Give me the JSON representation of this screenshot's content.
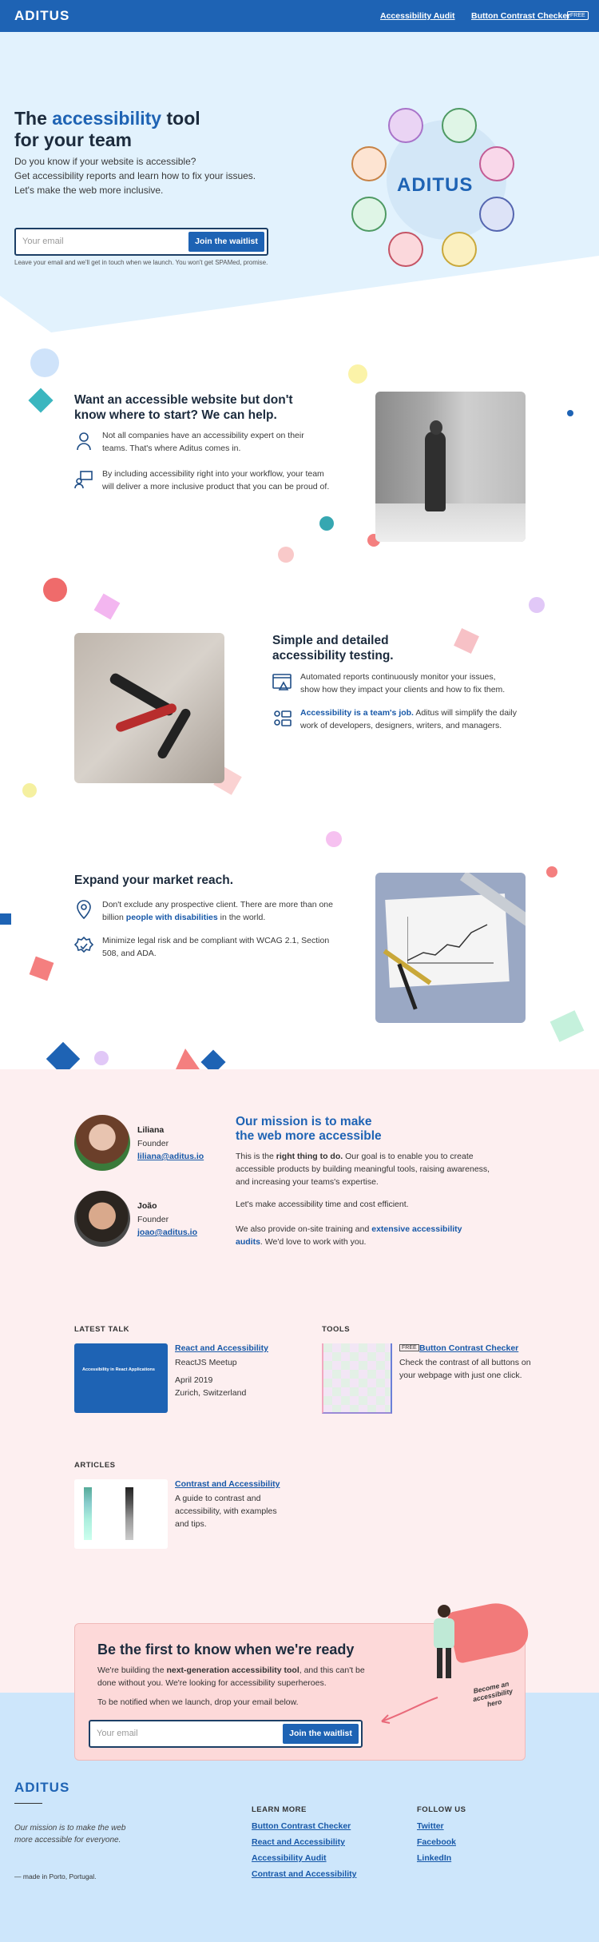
{
  "header": {
    "logo": "ADITUS",
    "nav": [
      "Accessibility Audit",
      "Button Contrast Checker"
    ],
    "free_badge": "FREE"
  },
  "hero": {
    "title_pre": "The ",
    "title_accent": "accessibility",
    "title_post": " tool for your team",
    "subtitle": [
      "Do you know if your website is accessible?",
      "Get accessibility reports and learn how to fix your issues.",
      "Let's make the web more inclusive."
    ],
    "email_placeholder": "Your email",
    "button": "Join the waitlist",
    "note": "Leave your email and we'll get in touch when we launch. You won't get SPAMed, promise.",
    "logo": "ADITUS"
  },
  "feature1": {
    "title": "Want an accessible website but don't know where to start? We can help.",
    "items": [
      "Not all companies have an accessibility expert on their teams. That's where Aditus comes in.",
      "By including accessibility right into your workflow, your team will deliver a more inclusive product that you can be proud of."
    ]
  },
  "feature2": {
    "title": "Simple and detailed accessibility testing.",
    "items": [
      "Automated reports continuously monitor your issues, show how they impact your clients and how to fix them."
    ],
    "link": "Accessibility is a team's job.",
    "link_after": " Aditus will simplify the daily work of developers, designers, writers, and managers."
  },
  "feature3": {
    "title": "Expand your market reach.",
    "text_pre": "Don't exclude any prospective client. There are more than one billion ",
    "link": "people with disabilities",
    "text_post": " in the world.",
    "item2": "Minimize legal risk and be compliant with WCAG 2.1, Section 508, and ADA."
  },
  "team": [
    {
      "name": "Liliana",
      "role": "Founder",
      "email": "liliana@aditus.io"
    },
    {
      "name": "João",
      "role": "Founder",
      "email": "joao@aditus.io"
    }
  ],
  "mission": {
    "title": "Our mission is to make the web more accessible",
    "p1_pre": "This is the ",
    "p1_bold": "right thing to do.",
    "p1_post": " Our goal is to enable you to create accessible products by building meaningful tools, raising awareness, and increasing your teams's expertise.",
    "p2": "Let's make accessibility time and cost efficient.",
    "p3_pre": "We also provide on-site training and ",
    "p3_link": "extensive accessibility audits",
    "p3_post": ". We'd love to work with you."
  },
  "latest_talk": {
    "label": "LATEST TALK",
    "thumb_title": "Accessibility in React Applications",
    "link": "React and Accessibility",
    "event": "ReactJS Meetup",
    "date": "April 2019",
    "place": "Zurich, Switzerland"
  },
  "tools": {
    "label": "TOOLS",
    "badge": "FREE",
    "link": "Button Contrast Checker",
    "text": "Check the contrast of all buttons on your webpage with just one click."
  },
  "articles": {
    "label": "ARTICLES",
    "link": "Contrast and Accessibility",
    "text": "A guide to contrast and accessibility, with examples and tips."
  },
  "cta": {
    "title": "Be the first to know when we're ready",
    "p1_pre": "We're building the ",
    "p1_bold": "next-generation accessibility tool",
    "p1_post": ", and this can't be done without you. We're looking for accessibility superheroes.",
    "p2": "To be notified when we launch, drop your email below.",
    "email_placeholder": "Your email",
    "button": "Join the waitlist",
    "hand_note": "Become an accessibility hero"
  },
  "footer": {
    "logo": "ADITUS",
    "tagline": "Our mission is to make the web more accessible for everyone.",
    "made": "— made in Porto, Portugal.",
    "learn_head": "LEARN MORE",
    "learn": [
      "Button Contrast Checker",
      "React and Accessibility",
      "Accessibility Audit",
      "Contrast and Accessibility"
    ],
    "follow_head": "FOLLOW US",
    "follow": [
      "Twitter",
      "Facebook",
      "LinkedIn"
    ]
  },
  "colors": {
    "brand": "#1e63b4",
    "hero_bg": "#e2f2fd",
    "mission_bg": "#fdeff0",
    "cta_bg": "#fdd9d9",
    "footer_bg": "#cde6fb"
  }
}
